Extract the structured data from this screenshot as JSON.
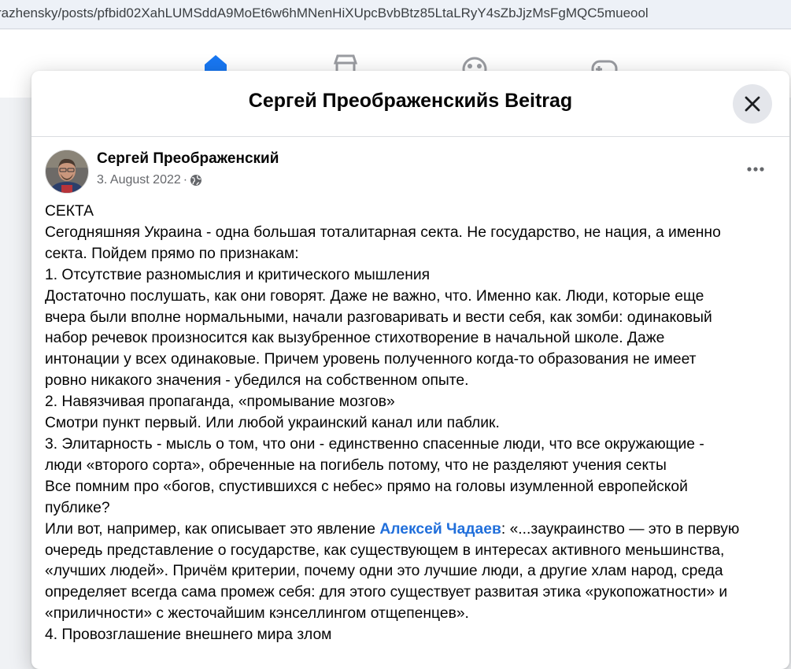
{
  "browser": {
    "url": "razhensky/posts/pfbid02XahLUMSddA9MoEt6w6hMNenHiXUpcBvbBtz85LtaLRyY4sZbJjzMsFgMQC5mueool"
  },
  "nav": {
    "icons": [
      "home-icon",
      "marketplace-icon",
      "groups-icon",
      "gaming-icon"
    ],
    "active_color": "#1877f2",
    "inactive_color": "#65676b"
  },
  "modal": {
    "title": "Сергей Преображенскийs Beitrag",
    "close_icon": "close-icon"
  },
  "post": {
    "author": "Сергей Преображенский",
    "date": "3. August 2022",
    "date_separator": "·",
    "privacy_icon": "globe-icon",
    "more_icon": "more-options-icon",
    "lines": [
      "СЕКТА",
      "Сегодняшняя Украина - одна большая тоталитарная секта. Не государство, не нация, а именно",
      "секта. Пойдем прямо по признакам:",
      "1. Отсутствие разномыслия и критического мышления",
      "Достаточно послушать, как они говорят. Даже не важно, что. Именно как. Люди, которые еще",
      "вчера были вполне нормальными, начали разговаривать и вести себя, как зомби: одинаковый",
      "набор речевок произносится как вызубренное стихотворение в начальной школе. Даже",
      "интонации у всех одинаковые. Причем уровень полученного когда-то образования не имеет",
      "ровно никакого значения - убедился на собственном опыте.",
      "2. Навязчивая пропаганда, «промывание мозгов»",
      "Смотри пункт первый. Или любой украинский канал или паблик.",
      "3. Элитарность - мысль о том, что они - единственно спасенные люди, что все окружающие -",
      "люди «второго сорта», обреченные на погибель потому, что не разделяют учения секты",
      "Все помним про «богов, спустившихся с небес» прямо на головы изумленной европейской",
      "публике?"
    ],
    "mention_line": {
      "before": "Или вот, например, как описывает это явление ",
      "mention": "Алексей Чадаев",
      "after": ": «...заукраинство — это в первую"
    },
    "lines_after": [
      "очередь представление о государстве, как существующем в интересах активного меньшинства,",
      "«лучших людей». Причём критерии, почему одни это лучшие люди, а другие хлам народ, среда",
      "определяет всегда сама промеж себя: для этого существует развитая этика «рукопожатности» и",
      "«приличности» с жесточайшим кэнселлингом отщепенцев».",
      "4. Провозглашение внешнего мира злом"
    ],
    "mention_color": "#216fdb"
  }
}
